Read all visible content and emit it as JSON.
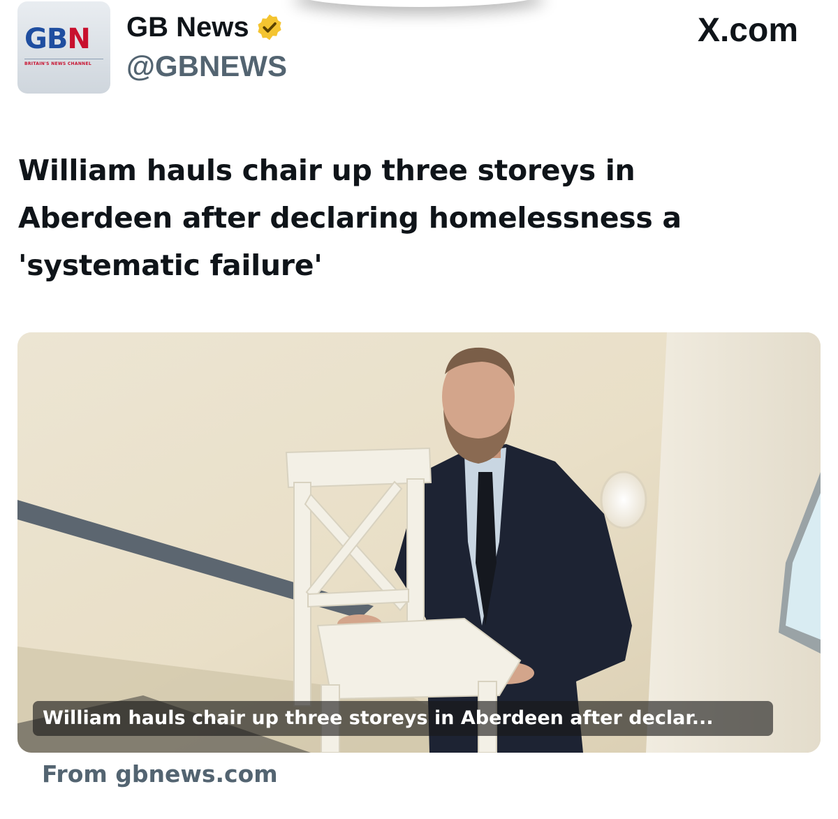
{
  "header": {
    "avatar_logo": {
      "part1": "GB",
      "part2": "N"
    },
    "avatar_tagline": "BRITAIN'S NEWS CHANNEL",
    "display_name": "GB News",
    "handle": "@GBNEWS",
    "source_site": "X.com",
    "verified_badge_color": "#f4c430"
  },
  "post": {
    "headline": "William hauls chair up three storeys in Aberdeen after declaring homelessness a 'systematic failure'"
  },
  "link_card": {
    "image_icon": "photo-of-man-carrying-white-chair-up-stairs",
    "caption": "William hauls chair up three storeys in Aberdeen after declar...",
    "from_label": "From gbnews.com"
  }
}
